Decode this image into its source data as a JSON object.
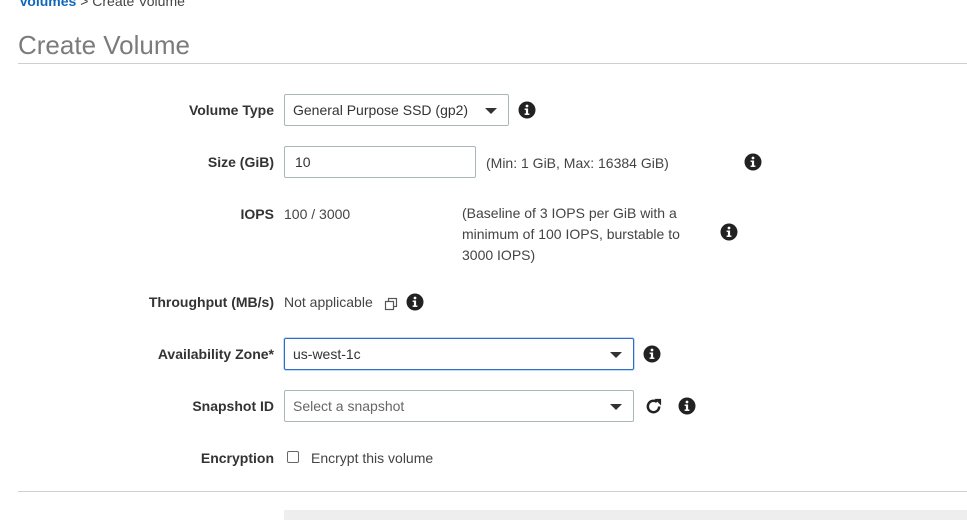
{
  "breadcrumb": {
    "parent": "Volumes",
    "separator": ">",
    "current": "Create Volume"
  },
  "page_title": "Create Volume",
  "form": {
    "volume_type": {
      "label": "Volume Type",
      "value": "General Purpose SSD (gp2)"
    },
    "size": {
      "label": "Size (GiB)",
      "value": "10",
      "hint": "(Min: 1 GiB, Max: 16384 GiB)"
    },
    "iops": {
      "label": "IOPS",
      "value": "100 / 3000",
      "hint_lines": [
        "(Baseline of 3 IOPS per GiB with a",
        "minimum of 100 IOPS, burstable to",
        "3000 IOPS)"
      ]
    },
    "throughput": {
      "label": "Throughput (MB/s)",
      "value": "Not applicable"
    },
    "availability_zone": {
      "label": "Availability Zone*",
      "value": "us-west-1c"
    },
    "snapshot_id": {
      "label": "Snapshot ID",
      "placeholder": "Select a snapshot"
    },
    "encryption": {
      "label": "Encryption",
      "checkbox_label": "Encrypt this volume",
      "checked": false
    }
  },
  "icons": {
    "info": "info-icon",
    "refresh": "refresh-icon",
    "copy": "copy-icon",
    "caret": "chevron-down-icon"
  },
  "colors": {
    "link": "#1166bb",
    "focus_border": "#2d6fc4",
    "title": "#7b7b7b"
  }
}
